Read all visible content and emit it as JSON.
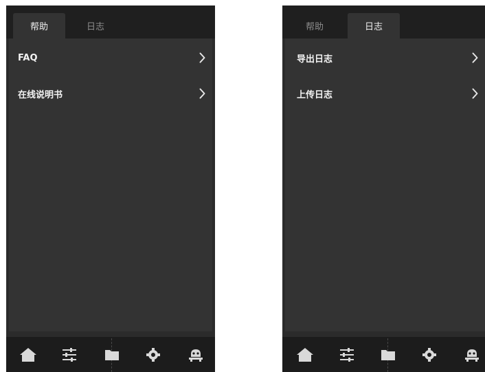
{
  "screens": [
    {
      "tabs": [
        {
          "label": "帮助",
          "active": true
        },
        {
          "label": "日志",
          "active": false
        }
      ],
      "items": [
        {
          "label": "FAQ"
        },
        {
          "label": "在线说明书"
        }
      ]
    },
    {
      "tabs": [
        {
          "label": "帮助",
          "active": false
        },
        {
          "label": "日志",
          "active": true
        }
      ],
      "items": [
        {
          "label": "导出日志"
        },
        {
          "label": "上传日志"
        }
      ]
    }
  ],
  "bottom_nav": {
    "icons": [
      "home-icon",
      "sliders-icon",
      "folder-icon",
      "gear-icon",
      "robot-icon"
    ]
  },
  "colors": {
    "background": "#2b2b2b",
    "panel": "#333333",
    "tabbar": "#1f1f1f",
    "nav": "#1c1c1c",
    "text": "#f2f2f2",
    "muted": "#8c8c8c",
    "icon": "#d9d9d9"
  }
}
